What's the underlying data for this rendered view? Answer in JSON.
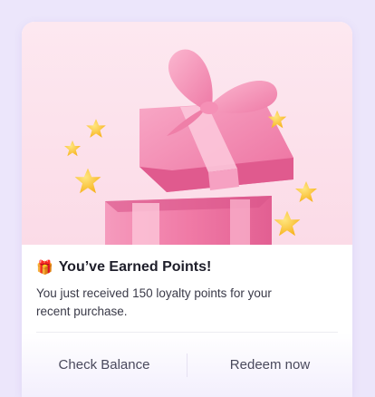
{
  "notification": {
    "icon": "gift-icon",
    "icon_glyph": "🎁",
    "title": "You’ve Earned Points!",
    "message": "You just received 150 loyalty points for your recent purchase.",
    "actions": {
      "check_balance": "Check Balance",
      "redeem_now": "Redeem now"
    }
  },
  "colors": {
    "page_bg": "#ece6fb",
    "hero_bg": "#fbdbe7",
    "gift_pink": "#f27aa6",
    "ribbon_pink": "#f48bb2",
    "star_yellow": "#ffc62e"
  }
}
